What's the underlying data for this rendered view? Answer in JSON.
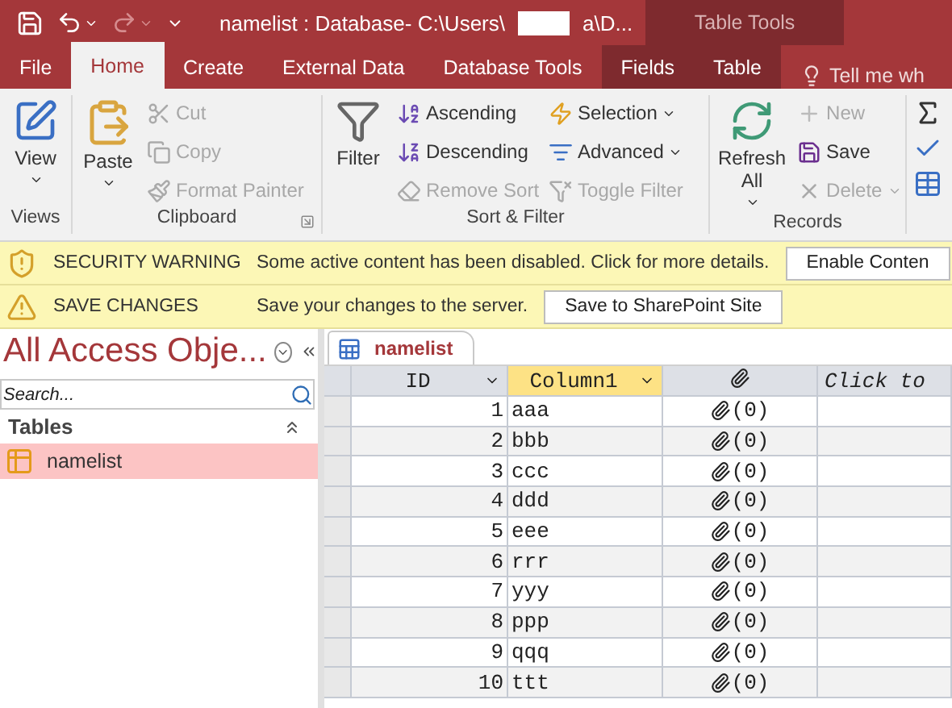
{
  "title_bar": {
    "title_start": "namelist : Database- C:\\Users\\",
    "title_end": "a\\D...",
    "context_label": "Table Tools"
  },
  "ribbon_tabs": [
    {
      "label": "File",
      "selected": false,
      "kind": "main"
    },
    {
      "label": "Home",
      "selected": true,
      "kind": "main"
    },
    {
      "label": "Create",
      "selected": false,
      "kind": "main"
    },
    {
      "label": "External Data",
      "selected": false,
      "kind": "main"
    },
    {
      "label": "Database Tools",
      "selected": false,
      "kind": "main"
    },
    {
      "label": "Fields",
      "selected": false,
      "kind": "contextual"
    },
    {
      "label": "Table",
      "selected": false,
      "kind": "contextual"
    }
  ],
  "tell_me": "Tell me wh",
  "ribbon_groups": [
    {
      "label": "Views",
      "columns": [
        [
          {
            "kind": "large",
            "label": "View",
            "dropdown": true,
            "disabled": false
          }
        ]
      ]
    },
    {
      "label": "Clipboard",
      "launcher": true,
      "columns": [
        [
          {
            "kind": "large",
            "label": "Paste",
            "dropdown": true,
            "disabled": false
          }
        ],
        [
          {
            "kind": "small",
            "label": "Cut",
            "disabled": true,
            "dropdown": false
          },
          {
            "kind": "small",
            "label": "Copy",
            "disabled": true,
            "dropdown": false
          },
          {
            "kind": "small",
            "label": "Format Painter",
            "disabled": true,
            "dropdown": false
          }
        ]
      ]
    },
    {
      "label": "Sort & Filter",
      "columns": [
        [
          {
            "kind": "large",
            "label": "Filter",
            "dropdown": false,
            "disabled": false
          }
        ],
        [
          {
            "kind": "small",
            "label": "Ascending",
            "disabled": false,
            "dropdown": false
          },
          {
            "kind": "small",
            "label": "Descending",
            "disabled": false,
            "dropdown": false
          },
          {
            "kind": "small",
            "label": "Remove Sort",
            "disabled": true,
            "dropdown": false
          }
        ],
        [
          {
            "kind": "small",
            "label": "Selection",
            "disabled": false,
            "dropdown": true
          },
          {
            "kind": "small",
            "label": "Advanced",
            "disabled": false,
            "dropdown": true
          },
          {
            "kind": "small",
            "label": "Toggle Filter",
            "disabled": true,
            "dropdown": false
          }
        ]
      ]
    },
    {
      "label": "Records",
      "columns": [
        [
          {
            "kind": "large",
            "label": "Refresh All",
            "dropdown": true,
            "disabled": false
          }
        ],
        [
          {
            "kind": "small",
            "label": "New",
            "disabled": true,
            "dropdown": false
          },
          {
            "kind": "small",
            "label": "Save",
            "disabled": false,
            "dropdown": false
          },
          {
            "kind": "small",
            "label": "Delete",
            "disabled": true,
            "dropdown": true
          }
        ]
      ]
    }
  ],
  "message_bars": [
    {
      "kind": "security",
      "title": "SECURITY WARNING",
      "text": "Some active content has been disabled. Click for more details.",
      "button": "Enable Conten"
    },
    {
      "kind": "save",
      "title": "SAVE CHANGES",
      "text": "Save your changes to the server.",
      "button": "Save to SharePoint Site"
    }
  ],
  "nav_pane": {
    "title": "All Access Obje...",
    "search_placeholder": "Search...",
    "group": "Tables",
    "items": [
      {
        "label": "namelist",
        "selected": true
      }
    ]
  },
  "document_tab": {
    "label": "namelist",
    "selected": true
  },
  "table": {
    "columns": [
      {
        "kind": "field",
        "label": "ID",
        "selected": false
      },
      {
        "kind": "field",
        "label": "Column1",
        "selected": true
      },
      {
        "kind": "attachment",
        "selected": false
      },
      {
        "kind": "add",
        "label": "Click to",
        "selected": false
      }
    ],
    "rows": [
      {
        "id": "1",
        "column1": "aaa",
        "attachments": "(0)"
      },
      {
        "id": "2",
        "column1": "bbb",
        "attachments": "(0)"
      },
      {
        "id": "3",
        "column1": "ccc",
        "attachments": "(0)"
      },
      {
        "id": "4",
        "column1": "ddd",
        "attachments": "(0)"
      },
      {
        "id": "5",
        "column1": "eee",
        "attachments": "(0)"
      },
      {
        "id": "6",
        "column1": "rrr",
        "attachments": "(0)"
      },
      {
        "id": "7",
        "column1": "yyy",
        "attachments": "(0)"
      },
      {
        "id": "8",
        "column1": "ppp",
        "attachments": "(0)"
      },
      {
        "id": "9",
        "column1": "qqq",
        "attachments": "(0)"
      },
      {
        "id": "10",
        "column1": "ttt",
        "attachments": "(0)"
      }
    ]
  }
}
